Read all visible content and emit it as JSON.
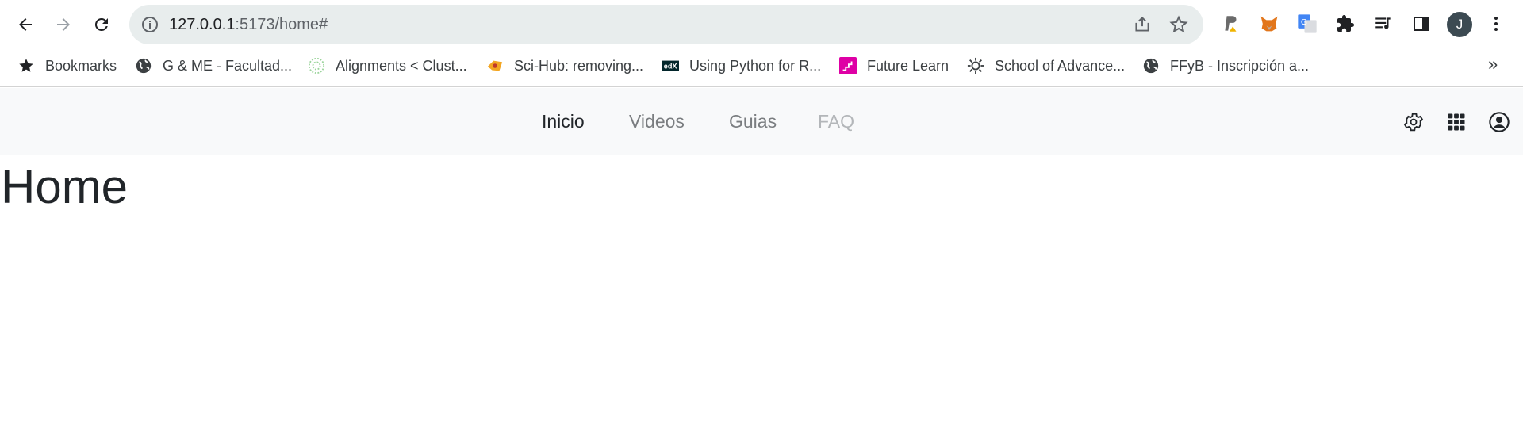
{
  "browser": {
    "url_host": "127.0.0.1",
    "url_path": ":5173/home#",
    "avatar_initial": "J"
  },
  "bookmarks": {
    "items": [
      {
        "label": "Bookmarks",
        "icon": "star-icon"
      },
      {
        "label": "G & ME - Facultad...",
        "icon": "globe-icon"
      },
      {
        "label": "Alignments < Clust...",
        "icon": "clustal-icon"
      },
      {
        "label": "Sci-Hub: removing...",
        "icon": "scihub-icon"
      },
      {
        "label": "Using Python for R...",
        "icon": "edx-icon"
      },
      {
        "label": "Future Learn",
        "icon": "futurelearn-icon"
      },
      {
        "label": "School of Advance...",
        "icon": "gear-sun-icon"
      },
      {
        "label": "FFyB - Inscripción a...",
        "icon": "globe-icon"
      }
    ],
    "more": "»"
  },
  "navbar": {
    "links": [
      {
        "label": "Inicio",
        "state": "active"
      },
      {
        "label": "Videos",
        "state": "normal"
      },
      {
        "label": "Guias",
        "state": "normal"
      },
      {
        "label": "FAQ",
        "state": "disabled"
      }
    ]
  },
  "main": {
    "title": "Home"
  },
  "colors": {
    "omnibox_bg": "#e8eded",
    "navbar_bg": "#f8f9fa",
    "text_dark": "#212529",
    "link_muted": "#7a7d80",
    "link_disabled": "#b3b6b9"
  }
}
